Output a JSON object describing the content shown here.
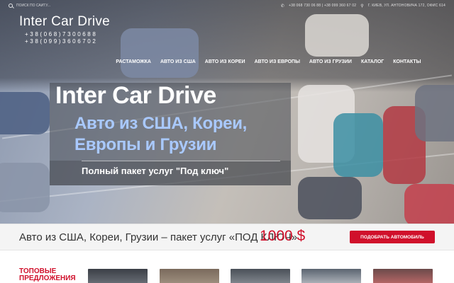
{
  "topbar": {
    "search_placeholder": "Поиск по сайту...",
    "phones_line": "+38 068 730 06 88 | +38 099 360 67 02",
    "address": "г. Киев, ул. Антоновича 172, офис 614"
  },
  "header": {
    "logo": "Inter Car Drive",
    "phone_1": "+38(068)7300688",
    "phone_2": "+38(099)3606702"
  },
  "nav": {
    "items": [
      "Растаможка",
      "Авто из США",
      "Авто из Кореи",
      "Авто из Европы",
      "Авто из Грузии",
      "Каталог",
      "Контакты"
    ]
  },
  "hero": {
    "title": "Inter Car Drive",
    "subtitle_line1": "Авто из США, Кореи,",
    "subtitle_line2": "Европы и Грузии",
    "tagline": "Полный пакет услуг \"Под ключ\""
  },
  "offer": {
    "text": "Авто из США, Кореи, Грузии – пакет услуг «ПОД КЛЮЧ»",
    "price": "1000 $",
    "button": "Подобрать автомобиль"
  },
  "top_offers": {
    "heading_line1": "Топовые",
    "heading_line2": "предложения"
  },
  "icons": {
    "search": "search-icon",
    "phone": "phone-icon",
    "location": "location-icon"
  },
  "colors": {
    "accent": "#d0102b",
    "hero_subtitle": "#a9c9ff"
  }
}
